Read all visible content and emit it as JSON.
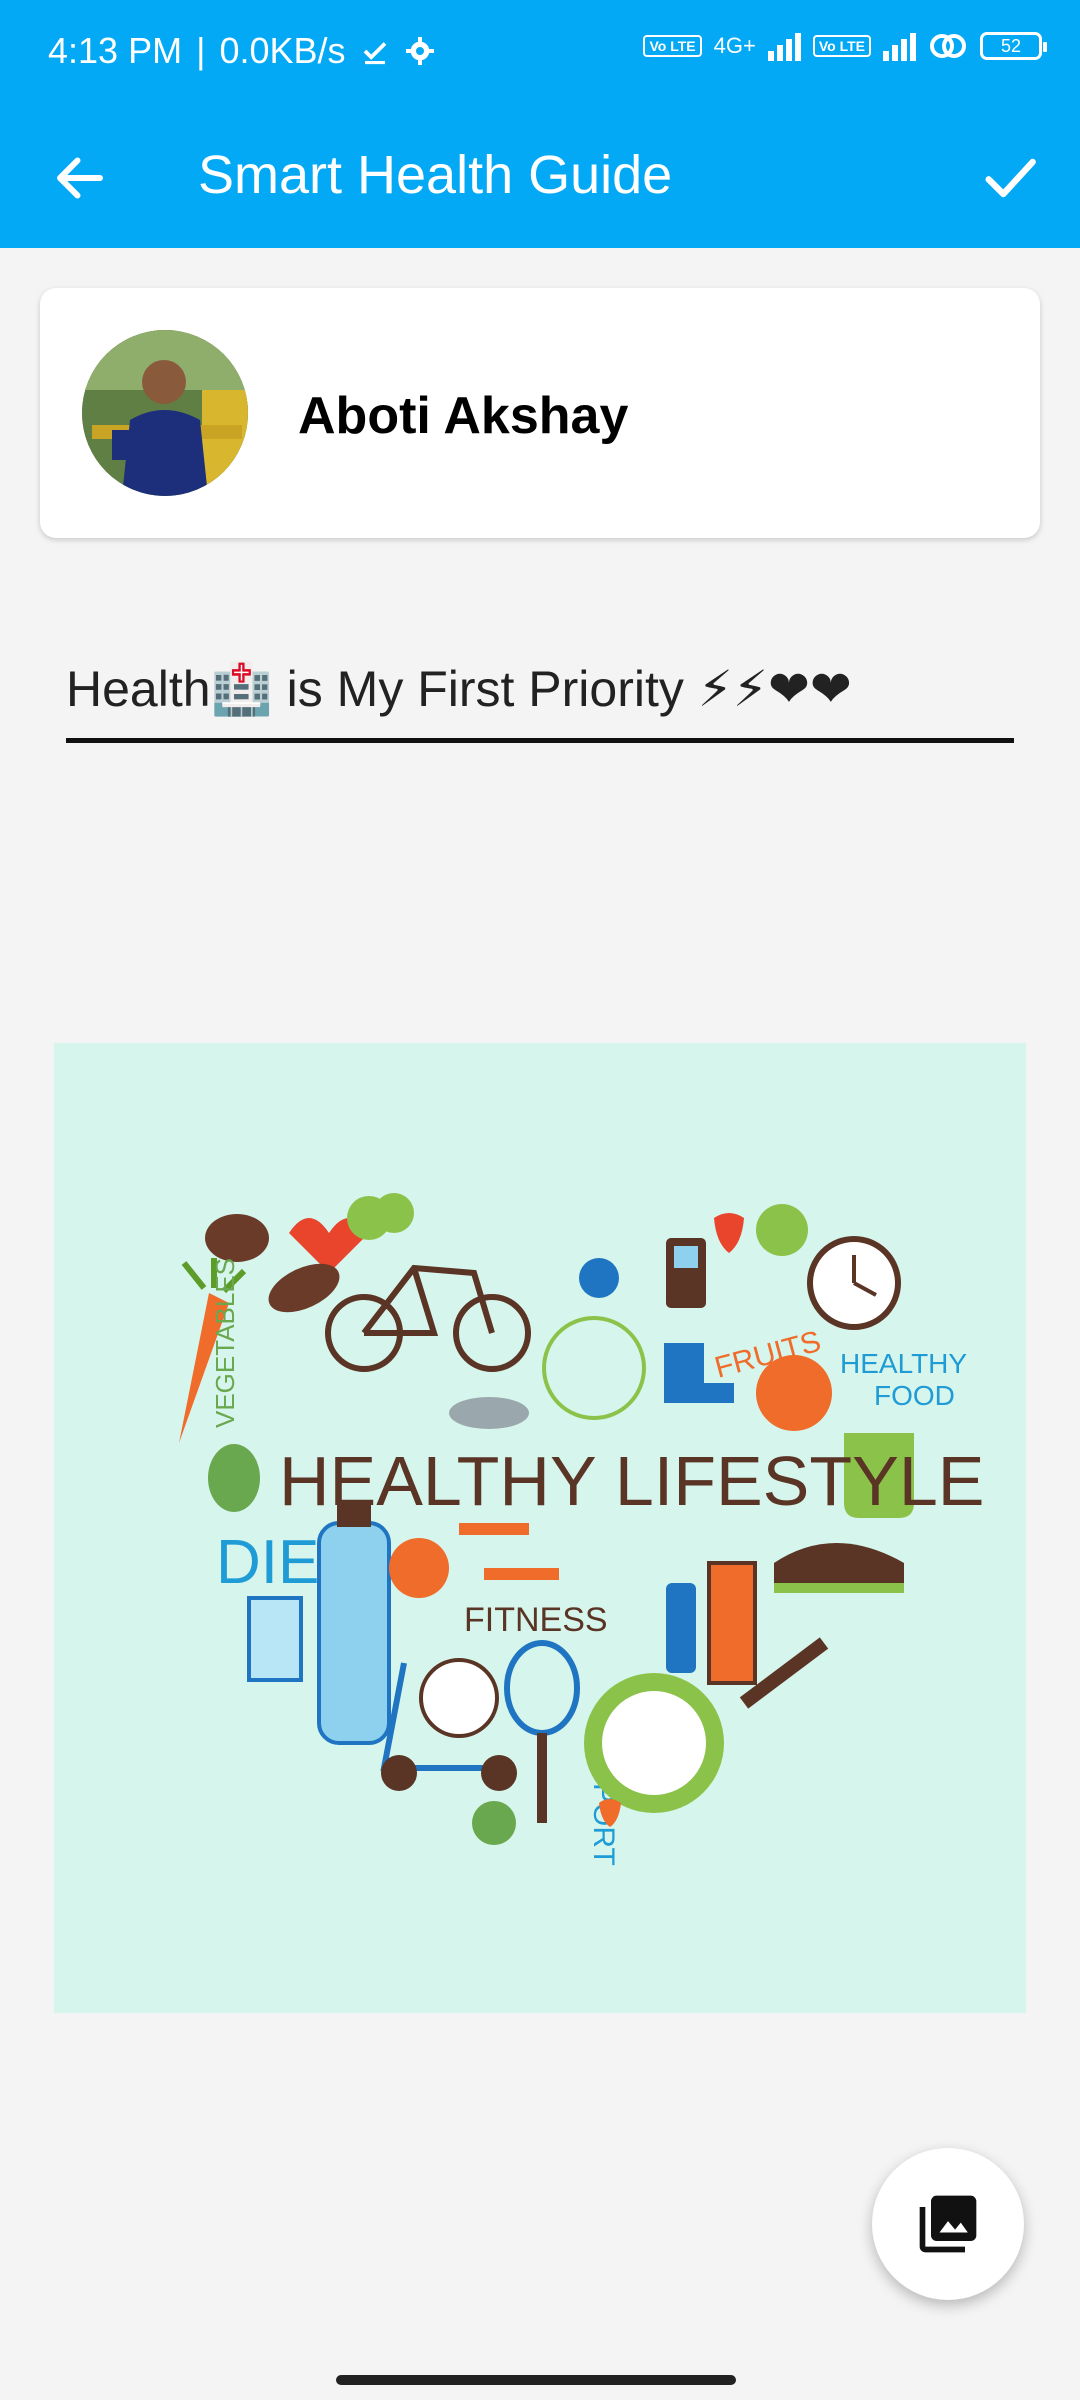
{
  "status_bar": {
    "time": "4:13 PM",
    "separator": "|",
    "network_speed": "0.0KB/s",
    "network_type": "4G+",
    "volte_label": "Vo LTE",
    "battery": "52",
    "icons": [
      "download-done-icon",
      "gear-icon",
      "signal-icon",
      "wifi-hotspot-icon",
      "battery-icon"
    ]
  },
  "app_bar": {
    "title": "Smart Health Guide",
    "back_icon": "arrow-back-icon",
    "confirm_icon": "check-icon",
    "color": "#03a9f4"
  },
  "profile": {
    "name": "Aboti Akshay"
  },
  "status_input": {
    "value": "Health🏥 is My First Priority ⚡⚡❤❤"
  },
  "poster": {
    "main_text": "HEALTHY LIFESTYLE",
    "labels": [
      "VEGETABLES",
      "DIET",
      "FITNESS",
      "SPORT",
      "FRUITS",
      "HEALTHY FOOD"
    ],
    "background": "#d6f5ec"
  },
  "fab": {
    "icon": "photo-library-icon"
  }
}
